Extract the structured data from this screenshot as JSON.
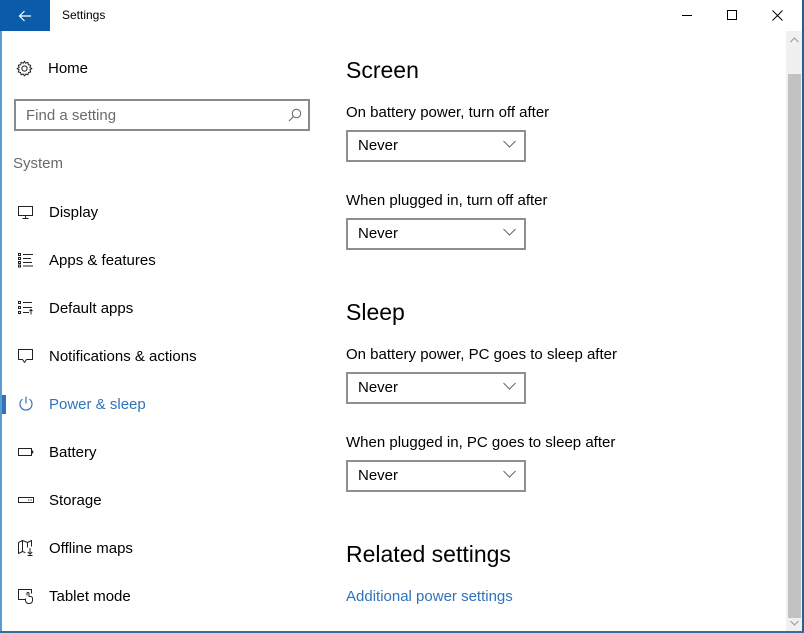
{
  "window": {
    "title": "Settings",
    "controls": {
      "minimize": "minimize",
      "maximize": "maximize",
      "close": "close"
    },
    "accent_color": "#0a5ba8"
  },
  "sidebar": {
    "home_label": "Home",
    "search_placeholder": "Find a setting",
    "group_label": "System",
    "active_color": "#2f74b8",
    "items": [
      {
        "label": "Display",
        "icon": "monitor-icon",
        "active": false
      },
      {
        "label": "Apps & features",
        "icon": "list-icon",
        "active": false
      },
      {
        "label": "Default apps",
        "icon": "default-apps-icon",
        "active": false
      },
      {
        "label": "Notifications & actions",
        "icon": "speech-bubble-icon",
        "active": false
      },
      {
        "label": "Power & sleep",
        "icon": "power-icon",
        "active": true
      },
      {
        "label": "Battery",
        "icon": "battery-icon",
        "active": false
      },
      {
        "label": "Storage",
        "icon": "storage-drive-icon",
        "active": false
      },
      {
        "label": "Offline maps",
        "icon": "map-download-icon",
        "active": false
      },
      {
        "label": "Tablet mode",
        "icon": "tablet-mode-icon",
        "active": false
      }
    ]
  },
  "main": {
    "screen": {
      "heading": "Screen",
      "battery_label": "On battery power, turn off after",
      "battery_value": "Never",
      "plugged_label": "When plugged in, turn off after",
      "plugged_value": "Never"
    },
    "sleep": {
      "heading": "Sleep",
      "battery_label": "On battery power, PC goes to sleep after",
      "battery_value": "Never",
      "plugged_label": "When plugged in, PC goes to sleep after",
      "plugged_value": "Never"
    },
    "related": {
      "heading": "Related settings",
      "link": "Additional power settings"
    }
  }
}
